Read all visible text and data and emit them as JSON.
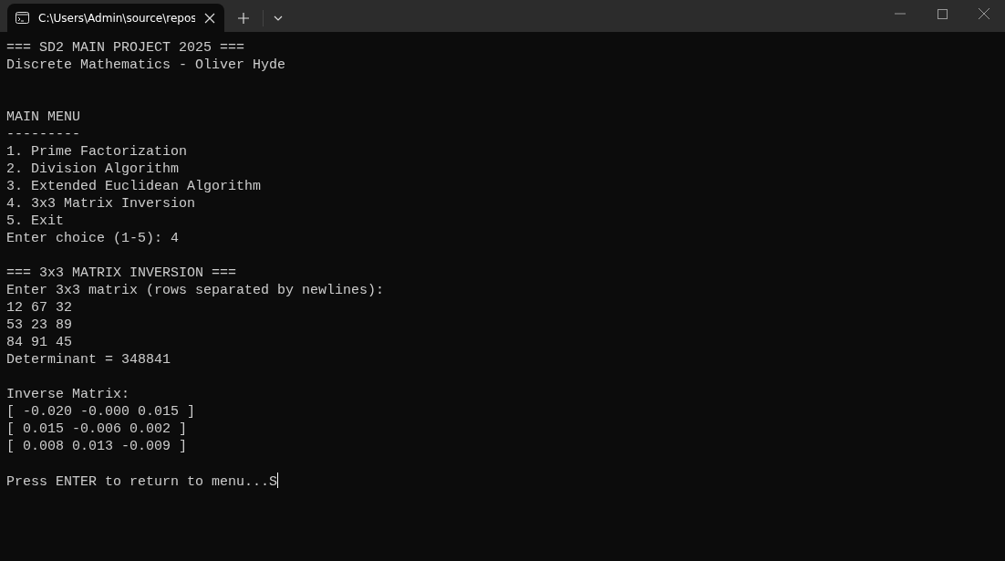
{
  "window": {
    "tab": {
      "title": "C:\\Users\\Admin\\source\\repos",
      "selected": true
    }
  },
  "terminal": {
    "lines": [
      {
        "kind": "text",
        "text": "=== SD2 MAIN PROJECT 2025 ==="
      },
      {
        "kind": "text",
        "text": "Discrete Mathematics - Oliver Hyde"
      },
      {
        "kind": "blank"
      },
      {
        "kind": "blank"
      },
      {
        "kind": "text",
        "text": "MAIN MENU"
      },
      {
        "kind": "text",
        "text": "---------"
      },
      {
        "kind": "text",
        "text": "1. Prime Factorization"
      },
      {
        "kind": "text",
        "text": "2. Division Algorithm"
      },
      {
        "kind": "text",
        "text": "3. Extended Euclidean Algorithm"
      },
      {
        "kind": "text",
        "text": "4. 3x3 Matrix Inversion"
      },
      {
        "kind": "text",
        "text": "5. Exit"
      },
      {
        "kind": "text",
        "text": "Enter choice (1-5): 4"
      },
      {
        "kind": "blank"
      },
      {
        "kind": "text",
        "text": "=== 3x3 MATRIX INVERSION ==="
      },
      {
        "kind": "text",
        "text": "Enter 3x3 matrix (rows separated by newlines):"
      },
      {
        "kind": "text",
        "text": "12 67 32"
      },
      {
        "kind": "text",
        "text": "53 23 89"
      },
      {
        "kind": "text",
        "text": "84 91 45"
      },
      {
        "kind": "text",
        "text": "Determinant = 348841"
      },
      {
        "kind": "blank"
      },
      {
        "kind": "text",
        "text": "Inverse Matrix:"
      },
      {
        "kind": "text",
        "text": "[ -0.020 -0.000 0.015 ]"
      },
      {
        "kind": "text",
        "text": "[ 0.015 -0.006 0.002 ]"
      },
      {
        "kind": "text",
        "text": "[ 0.008 0.013 -0.009 ]"
      },
      {
        "kind": "blank"
      },
      {
        "kind": "text",
        "text": "Press ENTER to return to menu...S"
      }
    ],
    "cursor": true
  }
}
